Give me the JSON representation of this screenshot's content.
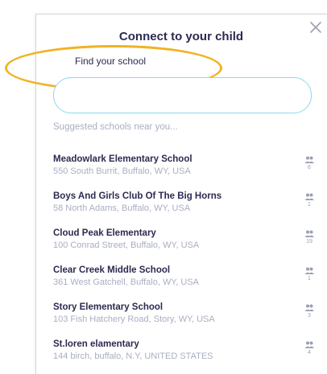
{
  "dialog": {
    "title": "Connect to your child",
    "close_icon": "close-icon",
    "find_label": "Find your school",
    "search": {
      "value": "",
      "placeholder": ""
    },
    "suggested_label": "Suggested schools near you...",
    "accent_color": "#87d9ef",
    "highlight_color": "#f0b323"
  },
  "schools": [
    {
      "name": "Meadowlark Elementary School",
      "address": "550 South Burrit, Buffalo, WY, USA",
      "count": "6",
      "icon": "users-icon"
    },
    {
      "name": "Boys And Girls Club Of The Big Horns",
      "address": "58 North Adams, Buffalo, WY, USA",
      "count": "1",
      "icon": "users-icon"
    },
    {
      "name": "Cloud Peak Elementary",
      "address": "100 Conrad Street, Buffalo, WY, USA",
      "count": "19",
      "icon": "users-icon"
    },
    {
      "name": "Clear Creek Middle School",
      "address": "361 West Gatchell, Buffalo, WY, USA",
      "count": "1",
      "icon": "users-icon"
    },
    {
      "name": "Story Elementary School",
      "address": "103 Fish Hatchery Road, Story, WY, USA",
      "count": "3",
      "icon": "users-icon"
    },
    {
      "name": "St.loren elamentary",
      "address": "144 birch, buffalo, N.Y, UNITED STATES",
      "count": "4",
      "icon": "users-icon"
    }
  ]
}
